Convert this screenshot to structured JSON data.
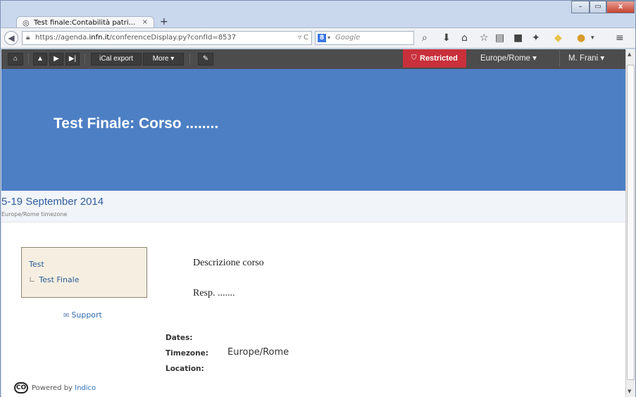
{
  "browser": {
    "tab_title": "Test finale:Contabilità patri...",
    "tab_close": "×",
    "new_tab": "+",
    "window_controls": [
      "–",
      "▭",
      "x"
    ],
    "url_prefix": "https://agenda.",
    "url_domain": "infn.it",
    "url_path": "/conferenceDisplay.py?confId=8537",
    "url_right": "▿ C",
    "search_engine_badge": "8",
    "search_placeholder": "Google",
    "toolbar_icons": [
      "search-icon",
      "download-icon",
      "home-icon",
      "star-icon",
      "reading-list-icon",
      "pocket-icon",
      "addon-icon",
      "notes-icon",
      "sync-icon",
      "menu-icon"
    ]
  },
  "indico_toolbar": {
    "ical_label": "iCal export",
    "more_label": "More",
    "restricted_label": "Restricted",
    "timezone_label": "Europe/Rome",
    "user_label": "M. Frani"
  },
  "event": {
    "title": "Test Finale: Corso ........",
    "dates": "5-19 September 2014",
    "timezone_note": "Europe/Rome timezone"
  },
  "menu": {
    "item1": "Test",
    "item2": "Test Finale",
    "support": "Support"
  },
  "description": {
    "line1": "Descrizione corso",
    "line2": "Resp. ......."
  },
  "details": {
    "dates_label": "Dates:",
    "timezone_label": "Timezone:",
    "timezone_value": "Europe/Rome",
    "location_label": "Location:"
  },
  "footer": {
    "logo_text": "CO",
    "powered_text": "Powered by ",
    "powered_link": "Indico"
  },
  "colors": {
    "banner": "#4d7fc4",
    "toolbar": "#4c4c4c",
    "restricted": "#c8303b",
    "link": "#2c5d99"
  }
}
